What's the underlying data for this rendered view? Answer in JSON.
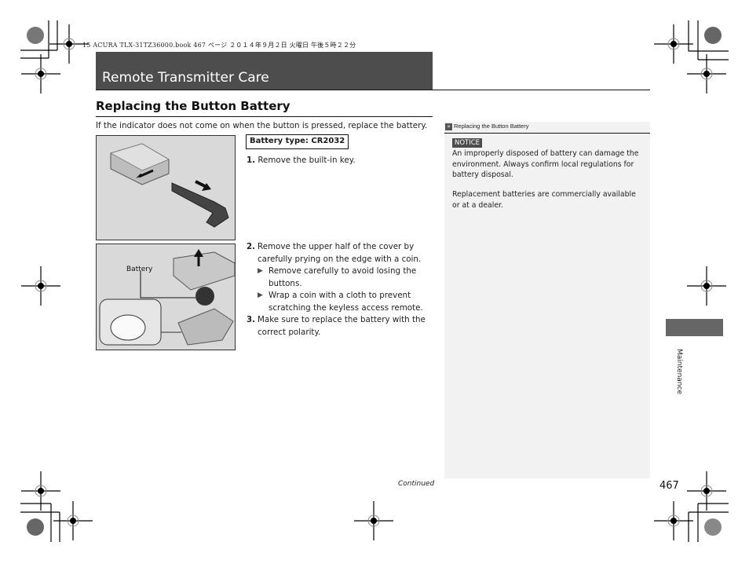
{
  "print_header": "15 ACURA TLX-31TZ36000.book  467 ページ  ２０１４年９月２日  火曜日  午後５時２２分",
  "page": {
    "title": "Remote Transmitter Care",
    "section_title": "Replacing the Button Battery",
    "intro": "If the indicator does not come on when the button is pressed, replace the battery.",
    "battery_spec": "Battery type: CR2032",
    "figure2_label": "Battery",
    "steps": [
      {
        "num": "1.",
        "text": "Remove the built-in key."
      },
      {
        "num": "2.",
        "text": "Remove the upper half of the cover by carefully prying on the edge with a coin.",
        "subs": [
          "Remove carefully to avoid losing the buttons.",
          "Wrap a coin with a cloth to prevent scratching the keyless access remote."
        ]
      },
      {
        "num": "3.",
        "text": "Make sure to replace the battery with the correct polarity."
      }
    ],
    "sub_arrow": "▶"
  },
  "sidebar": {
    "ref_icon": "»",
    "heading": "Replacing the Button Battery",
    "notice_label": "NOTICE",
    "notice_text": "An improperly disposed of battery can damage the environment. Always confirm local regulations for battery disposal.",
    "note_text": "Replacement batteries are commercially available or at a dealer."
  },
  "side_tab": "Maintenance",
  "footer": {
    "continued": "Continued",
    "page_number": "467"
  }
}
